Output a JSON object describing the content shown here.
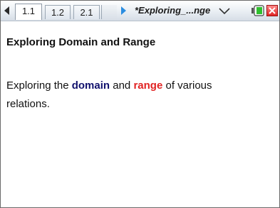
{
  "tabs": [
    {
      "label": "1.1",
      "active": true
    },
    {
      "label": "1.2",
      "active": false
    },
    {
      "label": "2.1",
      "active": false
    }
  ],
  "doc_title": "*Exploring_...nge",
  "icons": {
    "prev": "left-arrow-icon",
    "next": "right-arrow-icon",
    "dropdown": "chevron-down-icon",
    "battery": "battery-icon",
    "close": "close-icon"
  },
  "colors": {
    "domain": "#12126e",
    "range": "#e12323",
    "close": "#e02424",
    "battery": "#2fbf2f"
  },
  "content": {
    "heading": "Exploring Domain and Range",
    "paragraph": {
      "prefix": "Exploring the ",
      "domain": "domain",
      "middle": " and ",
      "range": "range",
      "suffix": " of various relations."
    }
  }
}
